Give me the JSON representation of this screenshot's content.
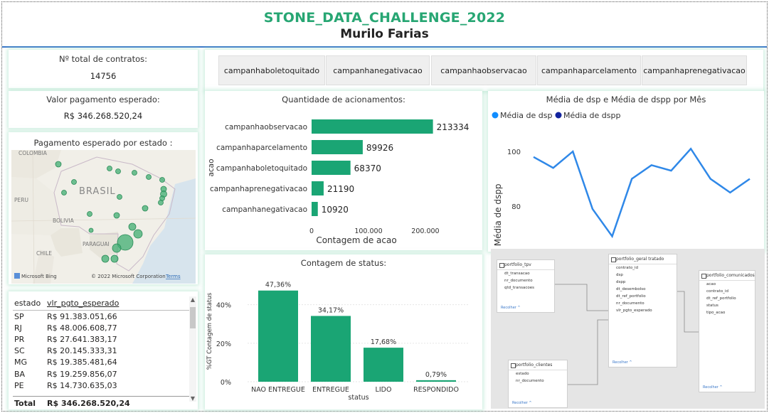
{
  "header": {
    "title": "STONE_DATA_CHALLENGE_2022",
    "subtitle": "Murilo Farias"
  },
  "kpis": {
    "contracts_label": "Nº total de contratos:",
    "contracts_value": "14756",
    "payment_label": "Valor pagamento esperado:",
    "payment_value": "R$ 346.268.520,24"
  },
  "segments": [
    "campanhaboletoquitado",
    "campanhanegativacao",
    "campanhaobservacao",
    "campanhaparcelamento",
    "campanhaprenegativacao"
  ],
  "map": {
    "title": "Pagamento esperado por estado :",
    "labels": {
      "brasil": "BRASIL",
      "colombia": "COLOMBIA",
      "peru": "PERU",
      "bolivia": "BOLIVIA",
      "paraguai": "PARAGUAI",
      "chile": "CHILE"
    },
    "bing": "Microsoft Bing",
    "copyright": "© 2022 Microsoft Corporation",
    "terms": "Terms"
  },
  "state_table": {
    "col1": "estado",
    "col2": "vlr_pgto_esperado",
    "rows": [
      [
        "SP",
        "R$ 91.383.051,66"
      ],
      [
        "RJ",
        "R$ 48.006.608,77"
      ],
      [
        "PR",
        "R$ 27.641.383,17"
      ],
      [
        "SC",
        "R$ 20.145.333,31"
      ],
      [
        "MG",
        "R$ 19.385.481,64"
      ],
      [
        "BA",
        "R$ 19.259.856,07"
      ],
      [
        "PE",
        "R$ 14.730.635,03"
      ]
    ],
    "total_label": "Total",
    "total_value": "R$ 346.268.520,24"
  },
  "chart_data": [
    {
      "type": "bar",
      "orientation": "horizontal",
      "title": "Quantidade de acionamentos:",
      "xlabel": "Contagem de acao",
      "ylabel": "acao",
      "categories": [
        "campanhaobservacao",
        "campanhaparcelamento",
        "campanhaboletoquitado",
        "campanhaprenegativacao",
        "campanhanegativacao"
      ],
      "values": [
        213334,
        89926,
        68370,
        21190,
        10920
      ],
      "data_labels": [
        "213334",
        "89926",
        "68370",
        "21190",
        "10920"
      ],
      "xticks": [
        "0",
        "100.000",
        "200.000"
      ],
      "xlim": [
        0,
        230000
      ],
      "color": "#1aa574"
    },
    {
      "type": "bar",
      "title": "Contagem de status:",
      "xlabel": "status",
      "ylabel": "%GT Contagem de status",
      "categories": [
        "NAO ENTREGUE",
        "ENTREGUE",
        "LIDO",
        "RESPONDIDO"
      ],
      "values": [
        47.36,
        34.17,
        17.68,
        0.79
      ],
      "data_labels": [
        "47,36%",
        "34,17%",
        "17,68%",
        "0,79%"
      ],
      "yticks": [
        "0%",
        "20%",
        "40%"
      ],
      "ylim": [
        0,
        48
      ],
      "color": "#1aa574"
    },
    {
      "type": "line",
      "title": "Média de dsp e Média de dspp por Mês",
      "ylabel": "e Média de dspp",
      "legend": [
        "Média de dsp",
        "Média de dspp"
      ],
      "legend_colors": [
        "#118dff",
        "#12239e"
      ],
      "series": [
        {
          "name": "Média de dsp",
          "values": [
            98,
            94,
            100,
            79,
            69,
            90,
            95,
            93,
            101,
            90,
            85,
            90
          ]
        }
      ],
      "yticks": [
        "80",
        "100"
      ],
      "ylim": [
        66,
        106
      ],
      "color": "#2f88e8"
    }
  ],
  "model": {
    "tables": [
      {
        "name": "portfolio_tpv",
        "fields": [
          "dt_transacao",
          "nr_documento",
          "qtd_transacoes"
        ]
      },
      {
        "name": "portfolio_geral tratado",
        "fields": [
          "contrato_id",
          "dsp",
          "dspp",
          "dt_desembolso",
          "dt_ref_portfolio",
          "nr_documento",
          "vlr_pgto_esperado"
        ]
      },
      {
        "name": "portfolio_comunicados",
        "fields": [
          "acao",
          "contrato_id",
          "dt_ref_portfolio",
          "status",
          "tipo_acao"
        ]
      },
      {
        "name": "portfolio_clientes",
        "fields": [
          "estado",
          "nr_documento"
        ]
      }
    ],
    "collapse": "Recolher ^"
  }
}
